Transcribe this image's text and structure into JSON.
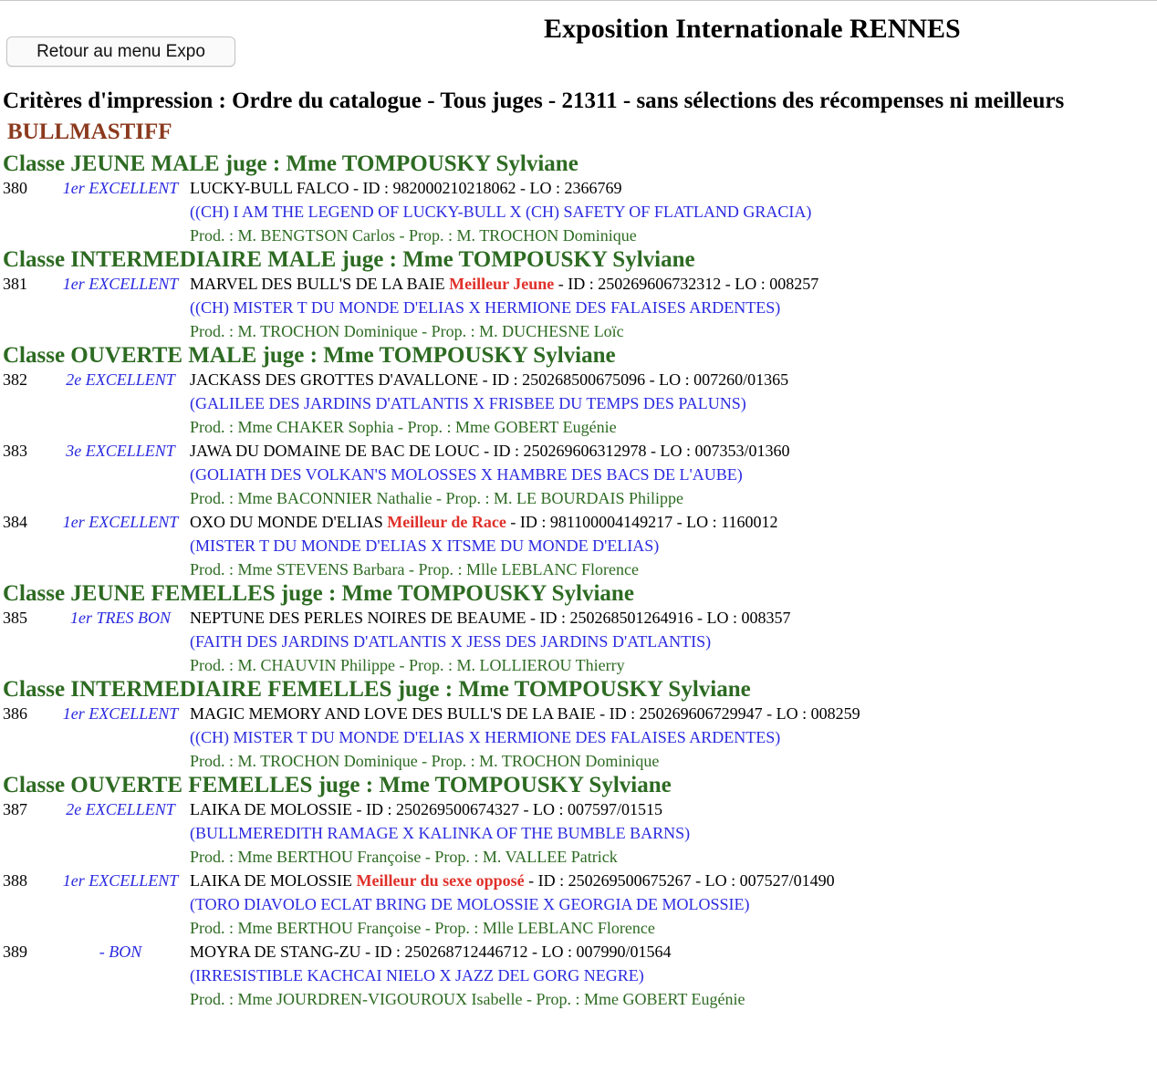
{
  "header": {
    "back_button": "Retour au menu Expo",
    "title": "Exposition Internationale RENNES",
    "criteria": "Critères d'impression : Ordre du catalogue - Tous juges - 21311 - sans sélections des récompenses ni meilleurs",
    "breed": "BULLMASTIFF"
  },
  "colors": {
    "class_heading": "#2d6b22",
    "breed": "#8b3a1e",
    "award": "#2a2ae0",
    "distinction": "#e0302a",
    "owners": "#2d6b22"
  },
  "groups": [
    {
      "heading": "Classe JEUNE MALE juge : Mme TOMPOUSKY Sylviane",
      "entries": [
        {
          "number": "380",
          "award": "1er EXCELLENT",
          "name": "LUCKY-BULL FALCO",
          "distinction": "",
          "ids": " - ID : 982000210218062 - LO : 2366769",
          "parents": "((CH) I AM THE LEGEND OF LUCKY-BULL X (CH) SAFETY OF FLATLAND GRACIA)",
          "owners": "Prod. : M. BENGTSON Carlos - Prop. : M. TROCHON Dominique"
        }
      ]
    },
    {
      "heading": "Classe INTERMEDIAIRE MALE juge : Mme TOMPOUSKY Sylviane",
      "entries": [
        {
          "number": "381",
          "award": "1er EXCELLENT",
          "name": "MARVEL DES BULL'S DE LA BAIE",
          "distinction": "Meilleur Jeune",
          "ids": " - ID : 250269606732312 - LO : 008257",
          "parents": "((CH) MISTER T DU MONDE D'ELIAS X HERMIONE DES FALAISES ARDENTES)",
          "owners": "Prod. : M. TROCHON Dominique - Prop. : M. DUCHESNE Loïc"
        }
      ]
    },
    {
      "heading": "Classe OUVERTE MALE juge : Mme TOMPOUSKY Sylviane",
      "entries": [
        {
          "number": "382",
          "award": "2e EXCELLENT",
          "name": "JACKASS DES GROTTES D'AVALLONE",
          "distinction": "",
          "ids": " - ID : 250268500675096 - LO : 007260/01365",
          "parents": "(GALILEE DES JARDINS D'ATLANTIS X FRISBEE DU TEMPS DES PALUNS)",
          "owners": "Prod. : Mme CHAKER Sophia - Prop. : Mme GOBERT Eugénie"
        },
        {
          "number": "383",
          "award": "3e EXCELLENT",
          "name": "JAWA DU DOMAINE DE BAC DE LOUC",
          "distinction": "",
          "ids": " - ID : 250269606312978 - LO : 007353/01360",
          "parents": "(GOLIATH DES VOLKAN'S MOLOSSES X HAMBRE DES BACS DE L'AUBE)",
          "owners": "Prod. : Mme BACONNIER Nathalie - Prop. : M. LE BOURDAIS Philippe"
        },
        {
          "number": "384",
          "award": "1er EXCELLENT",
          "name": "OXO DU MONDE D'ELIAS",
          "distinction": "Meilleur de Race",
          "ids": " - ID : 981100004149217 - LO : 1160012",
          "parents": "(MISTER T DU MONDE D'ELIAS X ITSME DU MONDE D'ELIAS)",
          "owners": "Prod. : Mme STEVENS Barbara - Prop. : Mlle LEBLANC Florence"
        }
      ]
    },
    {
      "heading": "Classe JEUNE FEMELLES juge : Mme TOMPOUSKY Sylviane",
      "entries": [
        {
          "number": "385",
          "award": "1er TRES BON",
          "name": "NEPTUNE DES PERLES NOIRES DE BEAUME",
          "distinction": "",
          "ids": " - ID : 250268501264916 - LO : 008357",
          "parents": "(FAITH DES JARDINS D'ATLANTIS X JESS DES JARDINS D'ATLANTIS)",
          "owners": "Prod. : M. CHAUVIN Philippe - Prop. : M. LOLLIEROU Thierry"
        }
      ]
    },
    {
      "heading": "Classe INTERMEDIAIRE FEMELLES juge : Mme TOMPOUSKY Sylviane",
      "entries": [
        {
          "number": "386",
          "award": "1er EXCELLENT",
          "name": "MAGIC MEMORY AND LOVE DES BULL'S DE LA BAIE",
          "distinction": "",
          "ids": " - ID : 250269606729947 - LO : 008259",
          "parents": "((CH) MISTER T DU MONDE D'ELIAS X HERMIONE DES FALAISES ARDENTES)",
          "owners": "Prod. : M. TROCHON Dominique - Prop. : M. TROCHON Dominique"
        }
      ]
    },
    {
      "heading": "Classe OUVERTE FEMELLES juge : Mme TOMPOUSKY Sylviane",
      "entries": [
        {
          "number": "387",
          "award": "2e EXCELLENT",
          "name": "LAIKA DE MOLOSSIE",
          "distinction": "",
          "ids": " - ID : 250269500674327 - LO : 007597/01515",
          "parents": "(BULLMEREDITH RAMAGE X KALINKA OF THE BUMBLE BARNS)",
          "owners": "Prod. : Mme BERTHOU Françoise - Prop. : M. VALLEE Patrick"
        },
        {
          "number": "388",
          "award": "1er EXCELLENT",
          "name": "LAIKA DE MOLOSSIE",
          "distinction": "Meilleur du sexe opposé",
          "ids": " - ID : 250269500675267 - LO : 007527/01490",
          "parents": "(TORO DIAVOLO ECLAT BRING DE MOLOSSIE X GEORGIA DE MOLOSSIE)",
          "owners": "Prod. : Mme BERTHOU Françoise - Prop. : Mlle LEBLANC Florence"
        },
        {
          "number": "389",
          "award": "- BON",
          "name": "MOYRA DE STANG-ZU",
          "distinction": "",
          "ids": " - ID : 250268712446712 - LO : 007990/01564",
          "parents": "(IRRESISTIBLE KACHCAI NIELO X JAZZ DEL GORG NEGRE)",
          "owners": "Prod. : Mme JOURDREN-VIGOUROUX Isabelle - Prop. : Mme GOBERT Eugénie"
        }
      ]
    }
  ]
}
